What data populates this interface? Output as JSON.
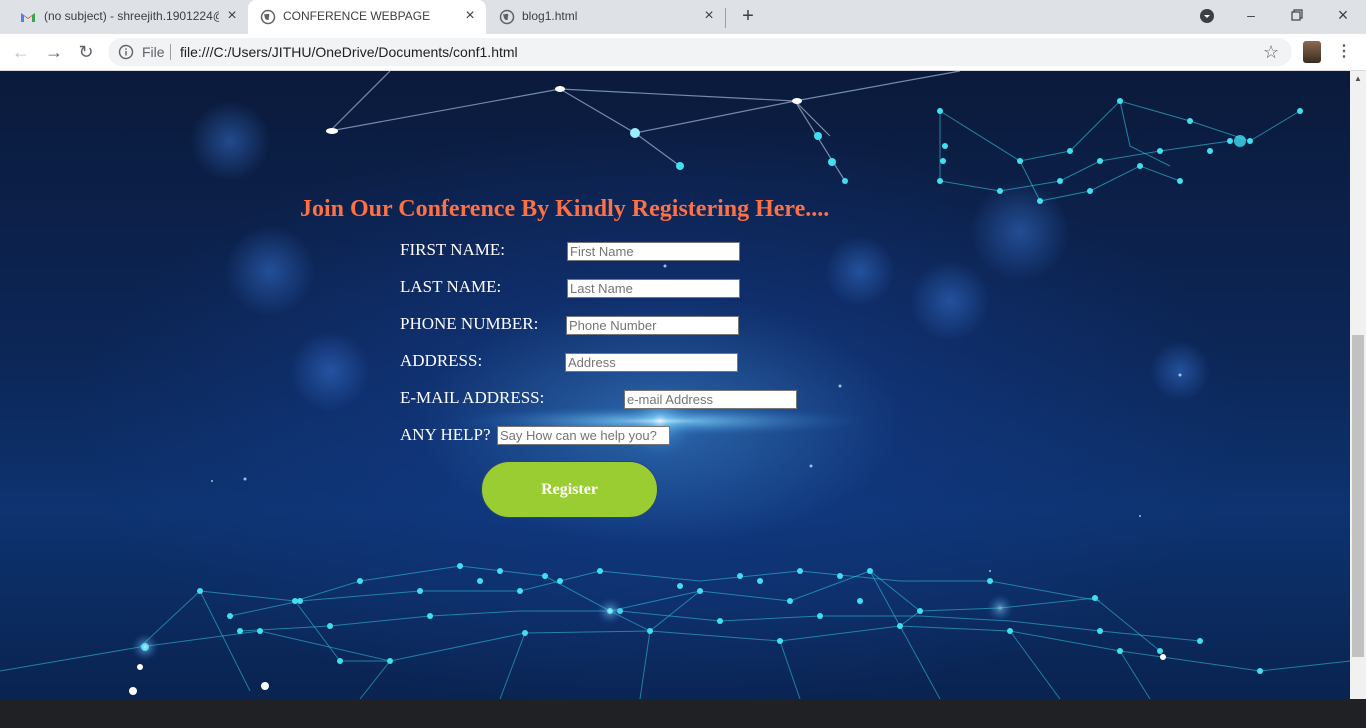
{
  "browser": {
    "tabs": [
      {
        "title": "(no subject) - shreejith.1901224@",
        "icon": "gmail-icon",
        "active": false
      },
      {
        "title": "CONFERENCE WEBPAGE",
        "icon": "globe-icon",
        "active": true
      },
      {
        "title": "blog1.html",
        "icon": "globe-icon",
        "active": false
      }
    ],
    "new_tab": "+",
    "address": {
      "scheme_label": "File",
      "url": "file:///C:/Users/JITHU/OneDrive/Documents/conf1.html"
    },
    "colors": {
      "tabstrip": "#dee1e6",
      "toolbar": "#ffffff"
    }
  },
  "page": {
    "heading": "Join Our Conference By Kindly Registering Here....",
    "fields": [
      {
        "label": "FIRST NAME:",
        "placeholder": "First Name"
      },
      {
        "label": "LAST NAME:",
        "placeholder": "Last Name"
      },
      {
        "label": "PHONE NUMBER:",
        "placeholder": "Phone Number"
      },
      {
        "label": "ADDRESS:",
        "placeholder": "Address"
      },
      {
        "label": "E-MAIL ADDRESS:",
        "placeholder": "e-mail Address"
      },
      {
        "label": "ANY HELP?",
        "placeholder": "Say How can we help you?"
      }
    ],
    "register_label": "Register",
    "colors": {
      "heading": "#ff7043",
      "register_bg": "#9acd32",
      "background": "#0c2657"
    }
  }
}
